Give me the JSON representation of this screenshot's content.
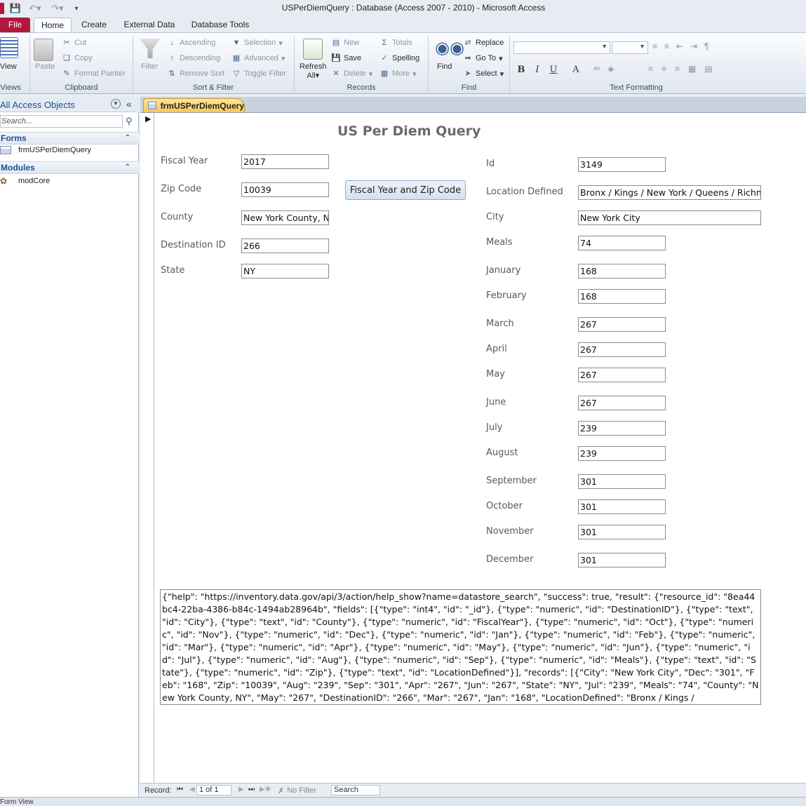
{
  "window": {
    "title": "USPerDiemQuery : Database (Access 2007 - 2010)  -  Microsoft Access"
  },
  "ribbon_tabs": [
    "File",
    "Home",
    "Create",
    "External Data",
    "Database Tools"
  ],
  "ribbon": {
    "views": {
      "view_label": "View",
      "group": "Views"
    },
    "clipboard": {
      "paste": "Paste",
      "cut": "Cut",
      "copy": "Copy",
      "format_painter": "Format Painter",
      "group": "Clipboard"
    },
    "sort_filter": {
      "filter": "Filter",
      "ascending": "Ascending",
      "descending": "Descending",
      "remove_sort": "Remove Sort",
      "selection": "Selection",
      "advanced": "Advanced",
      "toggle_filter": "Toggle Filter",
      "group": "Sort & Filter"
    },
    "records": {
      "refresh": "Refresh",
      "refresh_all": "All",
      "new": "New",
      "save": "Save",
      "delete": "Delete",
      "totals": "Totals",
      "spelling": "Spelling",
      "more": "More",
      "group": "Records"
    },
    "find": {
      "find": "Find",
      "replace": "Replace",
      "goto": "Go To",
      "select": "Select",
      "group": "Find"
    },
    "text_formatting": {
      "bold": "B",
      "italic": "I",
      "underline": "U",
      "font_color": "A",
      "group": "Text Formatting"
    }
  },
  "nav_pane": {
    "header": "All Access Objects",
    "search_placeholder": "Search...",
    "sections": [
      {
        "title": "Forms",
        "items": [
          "frmUSPerDiemQuery"
        ]
      },
      {
        "title": "Modules",
        "items": [
          "modCore"
        ]
      }
    ]
  },
  "document_tab": "frmUSPerDiemQuery",
  "form": {
    "heading": "US Per Diem Query",
    "button_label": "Fiscal Year and Zip Code",
    "left_fields": [
      {
        "label": "Fiscal Year",
        "value": "2017"
      },
      {
        "label": "Zip Code",
        "value": "10039"
      },
      {
        "label": "County",
        "value": "New York County, N"
      },
      {
        "label": "Destination ID",
        "value": "266"
      },
      {
        "label": "State",
        "value": "NY"
      }
    ],
    "right_fields": [
      {
        "label": "Id",
        "value": "3149"
      },
      {
        "label": "Location Defined",
        "value": "Bronx / Kings / New York / Queens / Richn"
      },
      {
        "label": "City",
        "value": "New York City"
      },
      {
        "label": "Meals",
        "value": "74"
      },
      {
        "label": "January",
        "value": "168"
      },
      {
        "label": "February",
        "value": "168"
      },
      {
        "label": "March",
        "value": "267"
      },
      {
        "label": "April",
        "value": "267"
      },
      {
        "label": "May",
        "value": "267"
      },
      {
        "label": "June",
        "value": "267"
      },
      {
        "label": "July",
        "value": "239"
      },
      {
        "label": "August",
        "value": "239"
      },
      {
        "label": "September",
        "value": "301"
      },
      {
        "label": "October",
        "value": "301"
      },
      {
        "label": "November",
        "value": "301"
      },
      {
        "label": "December",
        "value": "301"
      }
    ],
    "json_result": "{\"help\": \"https://inventory.data.gov/api/3/action/help_show?name=datastore_search\", \"success\": true, \"result\": {\"resource_id\": \"8ea44bc4-22ba-4386-b84c-1494ab28964b\", \"fields\": [{\"type\": \"int4\", \"id\": \"_id\"}, {\"type\": \"numeric\", \"id\": \"DestinationID\"}, {\"type\": \"text\", \"id\": \"City\"}, {\"type\": \"text\", \"id\": \"County\"}, {\"type\": \"numeric\", \"id\": \"FiscalYear\"}, {\"type\": \"numeric\", \"id\": \"Oct\"}, {\"type\": \"numeric\", \"id\": \"Nov\"}, {\"type\": \"numeric\", \"id\": \"Dec\"}, {\"type\": \"numeric\", \"id\": \"Jan\"}, {\"type\": \"numeric\", \"id\": \"Feb\"}, {\"type\": \"numeric\", \"id\": \"Mar\"}, {\"type\": \"numeric\", \"id\": \"Apr\"}, {\"type\": \"numeric\", \"id\": \"May\"}, {\"type\": \"numeric\", \"id\": \"Jun\"}, {\"type\": \"numeric\", \"id\": \"Jul\"}, {\"type\": \"numeric\", \"id\": \"Aug\"}, {\"type\": \"numeric\", \"id\": \"Sep\"}, {\"type\": \"numeric\", \"id\": \"Meals\"}, {\"type\": \"text\", \"id\": \"State\"}, {\"type\": \"numeric\", \"id\": \"Zip\"}, {\"type\": \"text\", \"id\": \"LocationDefined\"}], \"records\": [{\"City\": \"New York City\", \"Dec\": \"301\", \"Feb\": \"168\", \"Zip\": \"10039\", \"Aug\": \"239\", \"Sep\": \"301\", \"Apr\": \"267\", \"Jun\": \"267\", \"State\": \"NY\", \"Jul\": \"239\", \"Meals\": \"74\", \"County\": \"New York County, NY\", \"May\": \"267\", \"DestinationID\": \"266\", \"Mar\": \"267\", \"Jan\": \"168\", \"LocationDefined\": \"Bronx / Kings /"
  },
  "record_nav": {
    "label": "Record:",
    "position": "1 of 1",
    "filter": "No Filter",
    "search": "Search"
  },
  "status_bar": {
    "view": "Form View"
  }
}
